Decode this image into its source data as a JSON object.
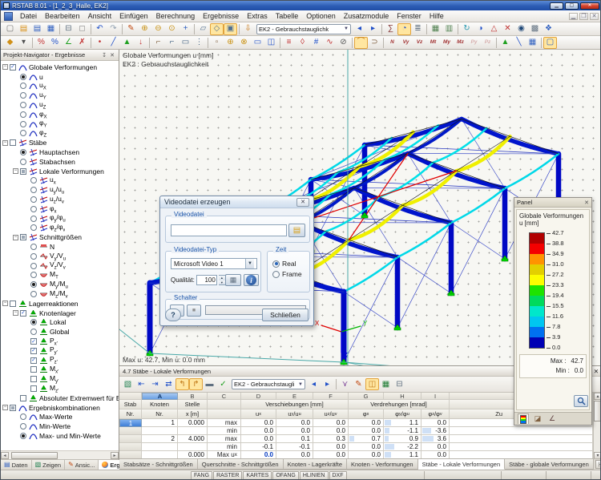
{
  "window": {
    "title": "RSTAB 8.01 - [1_2_3_Halle, EK2]"
  },
  "menubar": {
    "items": [
      "Datei",
      "Bearbeiten",
      "Ansicht",
      "Einfügen",
      "Berechnung",
      "Ergebnisse",
      "Extras",
      "Tabelle",
      "Optionen",
      "Zusatzmodule",
      "Fenster",
      "Hilfe"
    ]
  },
  "toolbars": {
    "case_combo": "EK2 - Gebrauchstauglichk",
    "row1": [
      {
        "n": "new-file-icon",
        "g": "▢",
        "c": "#707070"
      },
      {
        "n": "open-file-icon",
        "g": "▤",
        "c": "#d89018"
      },
      {
        "n": "open-project-icon",
        "g": "▤",
        "c": "#3060c0"
      },
      {
        "n": "save-icon",
        "g": "▦",
        "c": "#3060c0"
      },
      "|",
      {
        "n": "print-icon",
        "g": "⊟",
        "c": "#607080"
      },
      {
        "n": "print-preview-icon",
        "g": "◻",
        "c": "#8a8a8a"
      },
      "|",
      {
        "n": "undo-icon",
        "g": "↶",
        "c": "#2050c8"
      },
      {
        "n": "redo-icon",
        "g": "↷",
        "c": "#90a0b0"
      },
      "|",
      {
        "n": "edit-icon",
        "g": "✎",
        "c": "#c04810"
      },
      {
        "n": "zoom-in-icon",
        "g": "⊕",
        "c": "#c89010"
      },
      {
        "n": "zoom-out-icon",
        "g": "⊖",
        "c": "#c89010"
      },
      {
        "n": "zoom-window-icon",
        "g": "⊙",
        "c": "#c89010"
      },
      {
        "n": "pan-view-icon",
        "g": "+",
        "c": "#3060c0"
      },
      "|",
      {
        "n": "work-plane-icon",
        "g": "▱",
        "c": "#507090"
      },
      {
        "n": "view-3d-icon",
        "g": "◇",
        "c": "#507090",
        "hl": true
      },
      {
        "n": "render-model-icon",
        "g": "▣",
        "c": "#507090",
        "hl": true
      },
      "|",
      {
        "n": "loadcase-list-icon",
        "g": "⇩",
        "c": "#c87818"
      },
      {
        "t": "combo",
        "n": "load-case-combo"
      },
      {
        "n": "previous-case-icon",
        "g": "◂",
        "c": "#2050c8"
      },
      {
        "n": "next-case-icon",
        "g": "▸",
        "c": "#2050c8"
      },
      "|",
      {
        "n": "calculation-icon",
        "g": "∑",
        "c": "#803030"
      },
      {
        "n": "results-onoff-icon",
        "g": "◔",
        "c": "#2050c8",
        "hl": true
      },
      {
        "n": "printout-report-icon",
        "g": "≣",
        "c": "#607080"
      },
      "|",
      {
        "n": "show-tables-icon",
        "g": "▦",
        "c": "#508050"
      },
      {
        "n": "show-panel-icon",
        "g": "▥",
        "c": "#508050"
      },
      "|",
      {
        "n": "rotate-view-icon",
        "g": "↻",
        "c": "#2898b0"
      },
      {
        "n": "mirror-icon",
        "g": "◑",
        "c": "#2050c8"
      },
      {
        "n": "warning-icon",
        "g": "△",
        "c": "#c03030"
      },
      {
        "n": "delete-results-icon",
        "g": "✕",
        "c": "#c03030"
      },
      {
        "n": "info-model-icon",
        "g": "◉",
        "c": "#204878"
      },
      {
        "n": "options-icon",
        "g": "▩",
        "c": "#607080"
      },
      {
        "n": "modules-icon",
        "g": "❖",
        "c": "#3060c0"
      }
    ],
    "row2": [
      {
        "n": "snap-icon",
        "g": "◆",
        "c": "#d09018"
      },
      {
        "n": "snap-options-icon",
        "g": "▾",
        "c": "#505050"
      },
      "|",
      {
        "n": "select-percent-icon",
        "g": "%",
        "c": "#c03030"
      },
      {
        "n": "select-scale-icon",
        "g": "%",
        "c": "#2050c8"
      },
      {
        "n": "select-angle-icon",
        "g": "∠",
        "c": "#20a020"
      },
      {
        "n": "select-clear-icon",
        "g": "✗",
        "c": "#c03030"
      },
      "|",
      {
        "n": "node-tool-icon",
        "g": "•",
        "c": "#c03030"
      },
      {
        "n": "member-tool-icon",
        "g": "╱",
        "c": "#2050c8"
      },
      {
        "n": "support-tool-icon",
        "g": "▲",
        "c": "#20a020"
      },
      {
        "n": "load-tool-icon",
        "g": "↓",
        "c": "#c03030"
      },
      "|",
      {
        "n": "flag-work-icon",
        "g": "⌐",
        "c": "#806040"
      },
      {
        "n": "flag-view-icon",
        "g": "⌐",
        "c": "#406080"
      },
      {
        "n": "edit-mode-icon",
        "g": "▭",
        "c": "#406080"
      },
      {
        "n": "grid-points-icon",
        "g": "⋮",
        "c": "#406080"
      },
      "|",
      {
        "n": "select-window-icon",
        "g": "▫",
        "c": "#806040"
      },
      {
        "n": "zoom-dynamic-icon",
        "g": "⊕",
        "c": "#c89010"
      },
      {
        "n": "rotate-dynamic-icon",
        "g": "⊗",
        "c": "#c89010"
      },
      {
        "n": "clip-box-icon",
        "g": "▭",
        "c": "#2050c8"
      },
      {
        "n": "clip-plane-icon",
        "g": "◫",
        "c": "#2050c8"
      },
      "|",
      {
        "n": "visibility-icon",
        "g": "≡",
        "c": "#c03030"
      },
      {
        "n": "user-view-icon",
        "g": "◊",
        "c": "#c03030"
      },
      {
        "n": "numbering-icon",
        "g": "#",
        "c": "#2050c8"
      },
      {
        "n": "result-diagram-icon",
        "g": "∿",
        "c": "#c03030"
      },
      {
        "n": "section-icon",
        "g": "⊘",
        "c": "#505050"
      },
      "|",
      {
        "n": "deformation-display-icon",
        "g": "⌒",
        "c": "#c07818",
        "hl": true
      },
      {
        "n": "grab-results-icon",
        "g": "⊃",
        "c": "#806040"
      },
      "|",
      {
        "n": "result-n-icon",
        "lbl": "N"
      },
      {
        "n": "result-vy-icon",
        "lbl": "Vy"
      },
      {
        "n": "result-vz-icon",
        "lbl": "Vz"
      },
      {
        "n": "result-mt-icon",
        "lbl": "Mt"
      },
      {
        "n": "result-my-icon",
        "lbl": "My"
      },
      {
        "n": "result-mz-icon",
        "lbl": "Mz"
      },
      {
        "n": "result-py-icon",
        "lbl": "Py",
        "dis": true
      },
      {
        "n": "result-pz-icon",
        "lbl": "Pz",
        "dis": true
      },
      "|",
      {
        "n": "supports-display-icon",
        "g": "▲",
        "c": "#20a020"
      },
      {
        "n": "members-display-icon",
        "g": "╲",
        "c": "#2050c8"
      },
      {
        "n": "tables-display-icon",
        "g": "▦",
        "c": "#3060c0"
      },
      "|",
      {
        "n": "table-window-icon",
        "g": "▢",
        "c": "#3060c0",
        "hl": true
      }
    ]
  },
  "navigator": {
    "title": "Projekt-Navigator - Ergebnisse",
    "tree": [
      {
        "lvl": 0,
        "exp": true,
        "ctrl": "check1",
        "icon": "deform-icon",
        "label": "Globale Verformungen"
      },
      {
        "lvl": 1,
        "ctrl": "radio1",
        "icon": "deform-icon",
        "label": "u"
      },
      {
        "lvl": 1,
        "ctrl": "radio0",
        "icon": "deform-icon",
        "label": "u_{X}"
      },
      {
        "lvl": 1,
        "ctrl": "radio0",
        "icon": "deform-icon",
        "label": "u_{Y}"
      },
      {
        "lvl": 1,
        "ctrl": "radio0",
        "icon": "deform-icon",
        "label": "u_{Z}"
      },
      {
        "lvl": 1,
        "ctrl": "radio0",
        "icon": "deform-icon",
        "label": "φ_{X}"
      },
      {
        "lvl": 1,
        "ctrl": "radio0",
        "icon": "deform-icon",
        "label": "φ_{Y}"
      },
      {
        "lvl": 1,
        "ctrl": "radio0",
        "icon": "deform-icon",
        "label": "φ_{Z}"
      },
      {
        "lvl": 0,
        "exp": true,
        "ctrl": "check0",
        "icon": "member-icon",
        "label": "Stäbe"
      },
      {
        "lvl": 1,
        "ctrl": "radio1",
        "icon": "member-icon",
        "label": "Hauptachsen"
      },
      {
        "lvl": 1,
        "ctrl": "radio0",
        "icon": "member-icon",
        "label": "Stabachsen"
      },
      {
        "lvl": 1,
        "exp": true,
        "ctrl": "checkm",
        "icon": "member-icon",
        "label": "Lokale Verformungen"
      },
      {
        "lvl": 2,
        "ctrl": "radio0",
        "icon": "member-icon",
        "label": "u_{x}"
      },
      {
        "lvl": 2,
        "ctrl": "radio0",
        "icon": "member-icon",
        "label": "u_{y}/u_{u}"
      },
      {
        "lvl": 2,
        "ctrl": "radio0",
        "icon": "member-icon",
        "label": "u_{z}/u_{v}"
      },
      {
        "lvl": 2,
        "ctrl": "radio0",
        "icon": "member-icon",
        "label": "φ_{x}"
      },
      {
        "lvl": 2,
        "ctrl": "radio0",
        "icon": "member-icon",
        "label": "φ_{y}/φ_{u}"
      },
      {
        "lvl": 2,
        "ctrl": "radio0",
        "icon": "member-icon",
        "label": "φ_{z}/φ_{v}"
      },
      {
        "lvl": 1,
        "exp": true,
        "ctrl": "checkm",
        "icon": "member-icon",
        "label": "Schnittgrößen"
      },
      {
        "lvl": 2,
        "ctrl": "radio0",
        "icon": "force-n-icon",
        "label": "N"
      },
      {
        "lvl": 2,
        "ctrl": "radio0",
        "icon": "force-v-icon",
        "label": "V_{y}/V_{u}"
      },
      {
        "lvl": 2,
        "ctrl": "radio0",
        "icon": "force-v-icon",
        "label": "V_{z}/V_{v}"
      },
      {
        "lvl": 2,
        "ctrl": "radio0",
        "icon": "force-m-icon",
        "label": "M_{T}"
      },
      {
        "lvl": 2,
        "ctrl": "radio1",
        "icon": "force-m-icon",
        "label": "M_{y}/M_{u}"
      },
      {
        "lvl": 2,
        "ctrl": "radio0",
        "icon": "force-m-icon",
        "label": "M_{z}/M_{v}"
      },
      {
        "lvl": 0,
        "exp": true,
        "ctrl": "check0",
        "icon": "support-icon",
        "label": "Lagerreaktionen"
      },
      {
        "lvl": 1,
        "exp": true,
        "ctrl": "check1",
        "icon": "support-icon",
        "label": "Knotenlager"
      },
      {
        "lvl": 2,
        "ctrl": "radio1",
        "icon": "support-icon",
        "label": "Lokal"
      },
      {
        "lvl": 2,
        "ctrl": "radio0",
        "icon": "support-icon",
        "label": "Global"
      },
      {
        "lvl": 2,
        "ctrl": "check1",
        "icon": "support-icon",
        "label": "P_{x'}"
      },
      {
        "lvl": 2,
        "ctrl": "check1",
        "icon": "support-icon",
        "label": "P_{y'}"
      },
      {
        "lvl": 2,
        "ctrl": "check1",
        "icon": "support-icon",
        "label": "P_{z'}"
      },
      {
        "lvl": 2,
        "ctrl": "check0",
        "icon": "support-icon",
        "label": "M_{x'}"
      },
      {
        "lvl": 2,
        "ctrl": "check0",
        "icon": "support-icon",
        "label": "M_{y'}"
      },
      {
        "lvl": 2,
        "ctrl": "check0",
        "icon": "support-icon",
        "label": "M_{z'}"
      },
      {
        "lvl": 1,
        "ctrl": "check0",
        "icon": "support-icon",
        "label": "Absoluter Extremwert für Ergebi"
      },
      {
        "lvl": 0,
        "exp": true,
        "ctrl": "checkm",
        "icon": "deform-icon",
        "label": "Ergebniskombinationen"
      },
      {
        "lvl": 1,
        "ctrl": "radio0",
        "icon": "deform-icon",
        "label": "Max-Werte"
      },
      {
        "lvl": 1,
        "ctrl": "radio0",
        "icon": "deform-icon",
        "label": "Min-Werte"
      },
      {
        "lvl": 1,
        "ctrl": "radio1",
        "icon": "deform-icon",
        "label": "Max- und Min-Werte"
      }
    ],
    "tabs": [
      {
        "label": "Daten",
        "icon": "data-tab-icon",
        "glyph": "▤",
        "color": "#3060c0"
      },
      {
        "label": "Zeigen",
        "icon": "display-tab-icon",
        "glyph": "▧",
        "color": "#208050"
      },
      {
        "label": "Ansic...",
        "icon": "views-tab-icon",
        "glyph": "✎",
        "color": "#c04810"
      },
      {
        "label": "Erge...",
        "icon": "results-tab-icon",
        "glyph": "",
        "color": "",
        "active": true
      }
    ]
  },
  "viewport": {
    "header_line1": "Globale Verformungen u [mm]",
    "header_line2": "EK2 : Gebrauchstauglichkeit",
    "status_text": "Max u: 42.7, Min u: 0.0 mm",
    "axis_labels": {
      "x": "X",
      "y": "Y",
      "z": "Z"
    }
  },
  "dialog": {
    "title": "Videodatei erzeugen",
    "file_group": "Videodatei",
    "file_value": "",
    "type_group": "Videodatei-Typ",
    "type_value": "Microsoft Video 1",
    "quality_label": "Qualität:",
    "quality_value": "100",
    "quality_unit": "[%]",
    "zeit_group": "Zeit",
    "zeit_options": [
      {
        "label": "Real",
        "selected": true
      },
      {
        "label": "Frame",
        "selected": false
      }
    ],
    "schalter_group": "Schalter",
    "help_label": "?",
    "close_label": "Schließen"
  },
  "panel": {
    "title": "Panel",
    "subtitle1": "Globale Verformungen",
    "subtitle2": "u [mm]",
    "scale": {
      "values": [
        "42.7",
        "38.8",
        "34.9",
        "31.0",
        "27.2",
        "23.3",
        "19.4",
        "15.5",
        "11.6",
        "7.8",
        "3.9",
        "0.0"
      ],
      "colors": [
        "#b10000",
        "#f40000",
        "#ff9300",
        "#e3cf00",
        "#fdfd00",
        "#1ee300",
        "#00da5c",
        "#00e7cb",
        "#00c6f0",
        "#0070f0",
        "#0000b4"
      ]
    },
    "max_label": "Max :",
    "max_value": "42.7",
    "min_label": "Min :",
    "min_value": "0.0"
  },
  "table": {
    "title": "4.7 Stäbe - Lokale Verformungen",
    "combo": "EK2 - Gebrauchstaugli",
    "col_letters": [
      "A",
      "B",
      "C",
      "D",
      "E",
      "F",
      "G",
      "H",
      "I"
    ],
    "hdr": {
      "stab": "Stab",
      "stab2": "Nr.",
      "knoten": "Knoten",
      "knoten2": "Nr.",
      "stelle": "Stelle",
      "stelle2": "x [m]",
      "versch": "Verschiebungen [mm]",
      "verdreh": "Verdrehungen [mrad]",
      "cols": [
        "u_{x}",
        "u_{y}/u_{u}",
        "u_{z}/u_{v}",
        "φ_{x}",
        "φ_{y}/φ_{u}",
        "φ_{z}/φ_{v}"
      ],
      "trailing": "Zu"
    },
    "rows": [
      {
        "stab": "1",
        "sel": true,
        "knoten": "1",
        "x": "0.000",
        "kind": "max",
        "vals": [
          "0.0",
          "0.0",
          "0.0",
          "0.0",
          "1.1",
          "0.0"
        ],
        "bars": [
          0,
          0,
          0,
          0,
          8,
          0
        ]
      },
      {
        "stab": "",
        "knoten": "",
        "x": "",
        "kind": "min",
        "vals": [
          "0.0",
          "0.0",
          "0.0",
          "0.0",
          "-1.1",
          "-3.6"
        ],
        "bars": [
          0,
          0,
          0,
          0,
          6,
          11
        ]
      },
      {
        "stab": "",
        "knoten": "2",
        "x": "4.000",
        "kind": "max",
        "vals": [
          "0.0",
          "0.1",
          "0.3",
          "0.7",
          "0.9",
          "3.6"
        ],
        "bars": [
          0,
          0,
          0,
          6,
          5,
          14
        ]
      },
      {
        "stab": "",
        "knoten": "",
        "x": "",
        "kind": "min",
        "vals": [
          "-0.1",
          "-0.1",
          "0.0",
          "0.0",
          "-2.2",
          "0.0"
        ],
        "bars": [
          0,
          0,
          0,
          0,
          12,
          0
        ]
      },
      {
        "stab": "",
        "knoten": "",
        "x": "0.000",
        "kind": "Max u_{x}",
        "vals": [
          "0.0",
          "0.0",
          "0.0",
          "0.0",
          "1.1",
          "0.0"
        ],
        "bold": 0,
        "bars": [
          0,
          0,
          0,
          0,
          8,
          0
        ]
      }
    ],
    "toolbar": [
      {
        "n": "table-export-icon",
        "g": "▧",
        "c": "#208050"
      },
      {
        "n": "table-up-icon",
        "g": "⇤",
        "c": "#2050c8"
      },
      {
        "n": "table-down-icon",
        "g": "⇥",
        "c": "#2050c8"
      },
      {
        "n": "table-sync-icon",
        "g": "⇄",
        "c": "#2050c8"
      },
      {
        "n": "table-prev-icon",
        "g": "↰",
        "c": "#c07818",
        "hl": true
      },
      {
        "n": "table-next-icon",
        "g": "↱",
        "c": "#c07818",
        "hl": true
      },
      {
        "n": "table-ruler-icon",
        "g": "▬",
        "c": "#607080"
      },
      {
        "n": "table-check-icon",
        "g": "✓",
        "c": "#20a020"
      },
      {
        "t": "combo",
        "n": "table-case-combo"
      },
      {
        "n": "table-case-prev-icon",
        "g": "◂",
        "c": "#2050c8"
      },
      {
        "n": "table-case-next-icon",
        "g": "▸",
        "c": "#2050c8"
      },
      "|",
      {
        "n": "table-filter-icon",
        "g": "⋎",
        "c": "#703090"
      },
      {
        "n": "table-edit-icon",
        "g": "✎",
        "c": "#c04810"
      },
      {
        "n": "table-color-icon",
        "g": "◫",
        "c": "#c07818",
        "hl": true
      },
      {
        "n": "table-excel-icon",
        "g": "▦",
        "c": "#1a7a30"
      },
      {
        "n": "table-print-icon",
        "g": "⊟",
        "c": "#607080"
      }
    ],
    "tabs": [
      "Stabsätze - Schnittgrößen",
      "Querschnitte - Schnittgrößen",
      "Knoten - Lagerkräfte",
      "Knoten - Verformungen",
      "Stäbe - Lokale Verformungen",
      "Stäbe - globale Verformungen"
    ],
    "active_tab": 4,
    "nav_buttons": [
      "|◂",
      "◂",
      "▸",
      "▸|"
    ]
  },
  "statusbar": {
    "buttons": [
      "FANG",
      "RASTER",
      "KARTES",
      "OFANG",
      "HLINIEN",
      "DXF"
    ]
  }
}
